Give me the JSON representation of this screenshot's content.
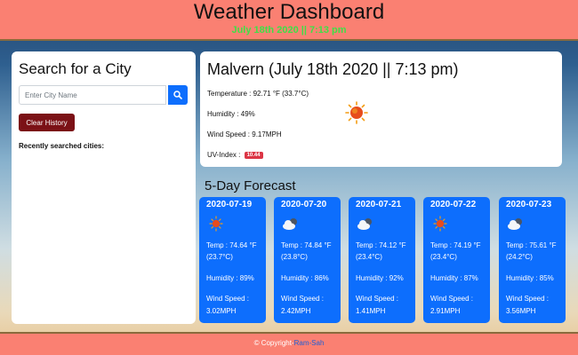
{
  "header": {
    "title": "Weather Dashboard",
    "date": "July 18th 2020 || 7:13 pm"
  },
  "sidebar": {
    "title": "Search for a City",
    "search_placeholder": "Enter City Name",
    "search_icon": "search-icon",
    "clear_label": "Clear History",
    "recent_label": "Recently searched cities:"
  },
  "current": {
    "city": "Malvern (July 18th 2020 || 7:13 pm)",
    "temperature": "Temperature : 92.71 °F (33.7°C)",
    "humidity": "Humidity : 49%",
    "wind": "Wind Speed : 9.17MPH",
    "uv_label": "UV-Index :",
    "uv_value": "10.44",
    "icon": "sun-icon"
  },
  "forecast": {
    "title": "5-Day Forecast",
    "days": [
      {
        "date": "2020-07-19",
        "icon": "sun-icon",
        "temp_f": "Temp : 74.64 °F",
        "temp_c": "(23.7°C)",
        "humidity": "Humidity : 89%",
        "wind_label": "Wind Speed :",
        "wind_value": "3.02MPH"
      },
      {
        "date": "2020-07-20",
        "icon": "cloud-icon",
        "temp_f": "Temp : 74.84 °F",
        "temp_c": "(23.8°C)",
        "humidity": "Humidity : 86%",
        "wind_label": "Wind Speed :",
        "wind_value": "2.42MPH"
      },
      {
        "date": "2020-07-21",
        "icon": "cloud-icon",
        "temp_f": "Temp : 74.12 °F",
        "temp_c": "(23.4°C)",
        "humidity": "Humidity : 92%",
        "wind_label": "Wind Speed :",
        "wind_value": "1.41MPH"
      },
      {
        "date": "2020-07-22",
        "icon": "sun-icon",
        "temp_f": "Temp : 74.19 °F",
        "temp_c": "(23.4°C)",
        "humidity": "Humidity : 87%",
        "wind_label": "Wind Speed :",
        "wind_value": "2.91MPH"
      },
      {
        "date": "2020-07-23",
        "icon": "cloud-icon",
        "temp_f": "Temp : 75.61 °F",
        "temp_c": "(24.2°C)",
        "humidity": "Humidity : 85%",
        "wind_label": "Wind Speed :",
        "wind_value": "3.56MPH"
      }
    ]
  },
  "footer": {
    "text": "© Copyright-",
    "author": "Ram-Sah"
  },
  "colors": {
    "header_bg": "#fa8072",
    "accent_blue": "#0d6efd",
    "clear_button": "#7b1116",
    "date_green": "#3fe046",
    "uv_badge": "#dc3545"
  }
}
